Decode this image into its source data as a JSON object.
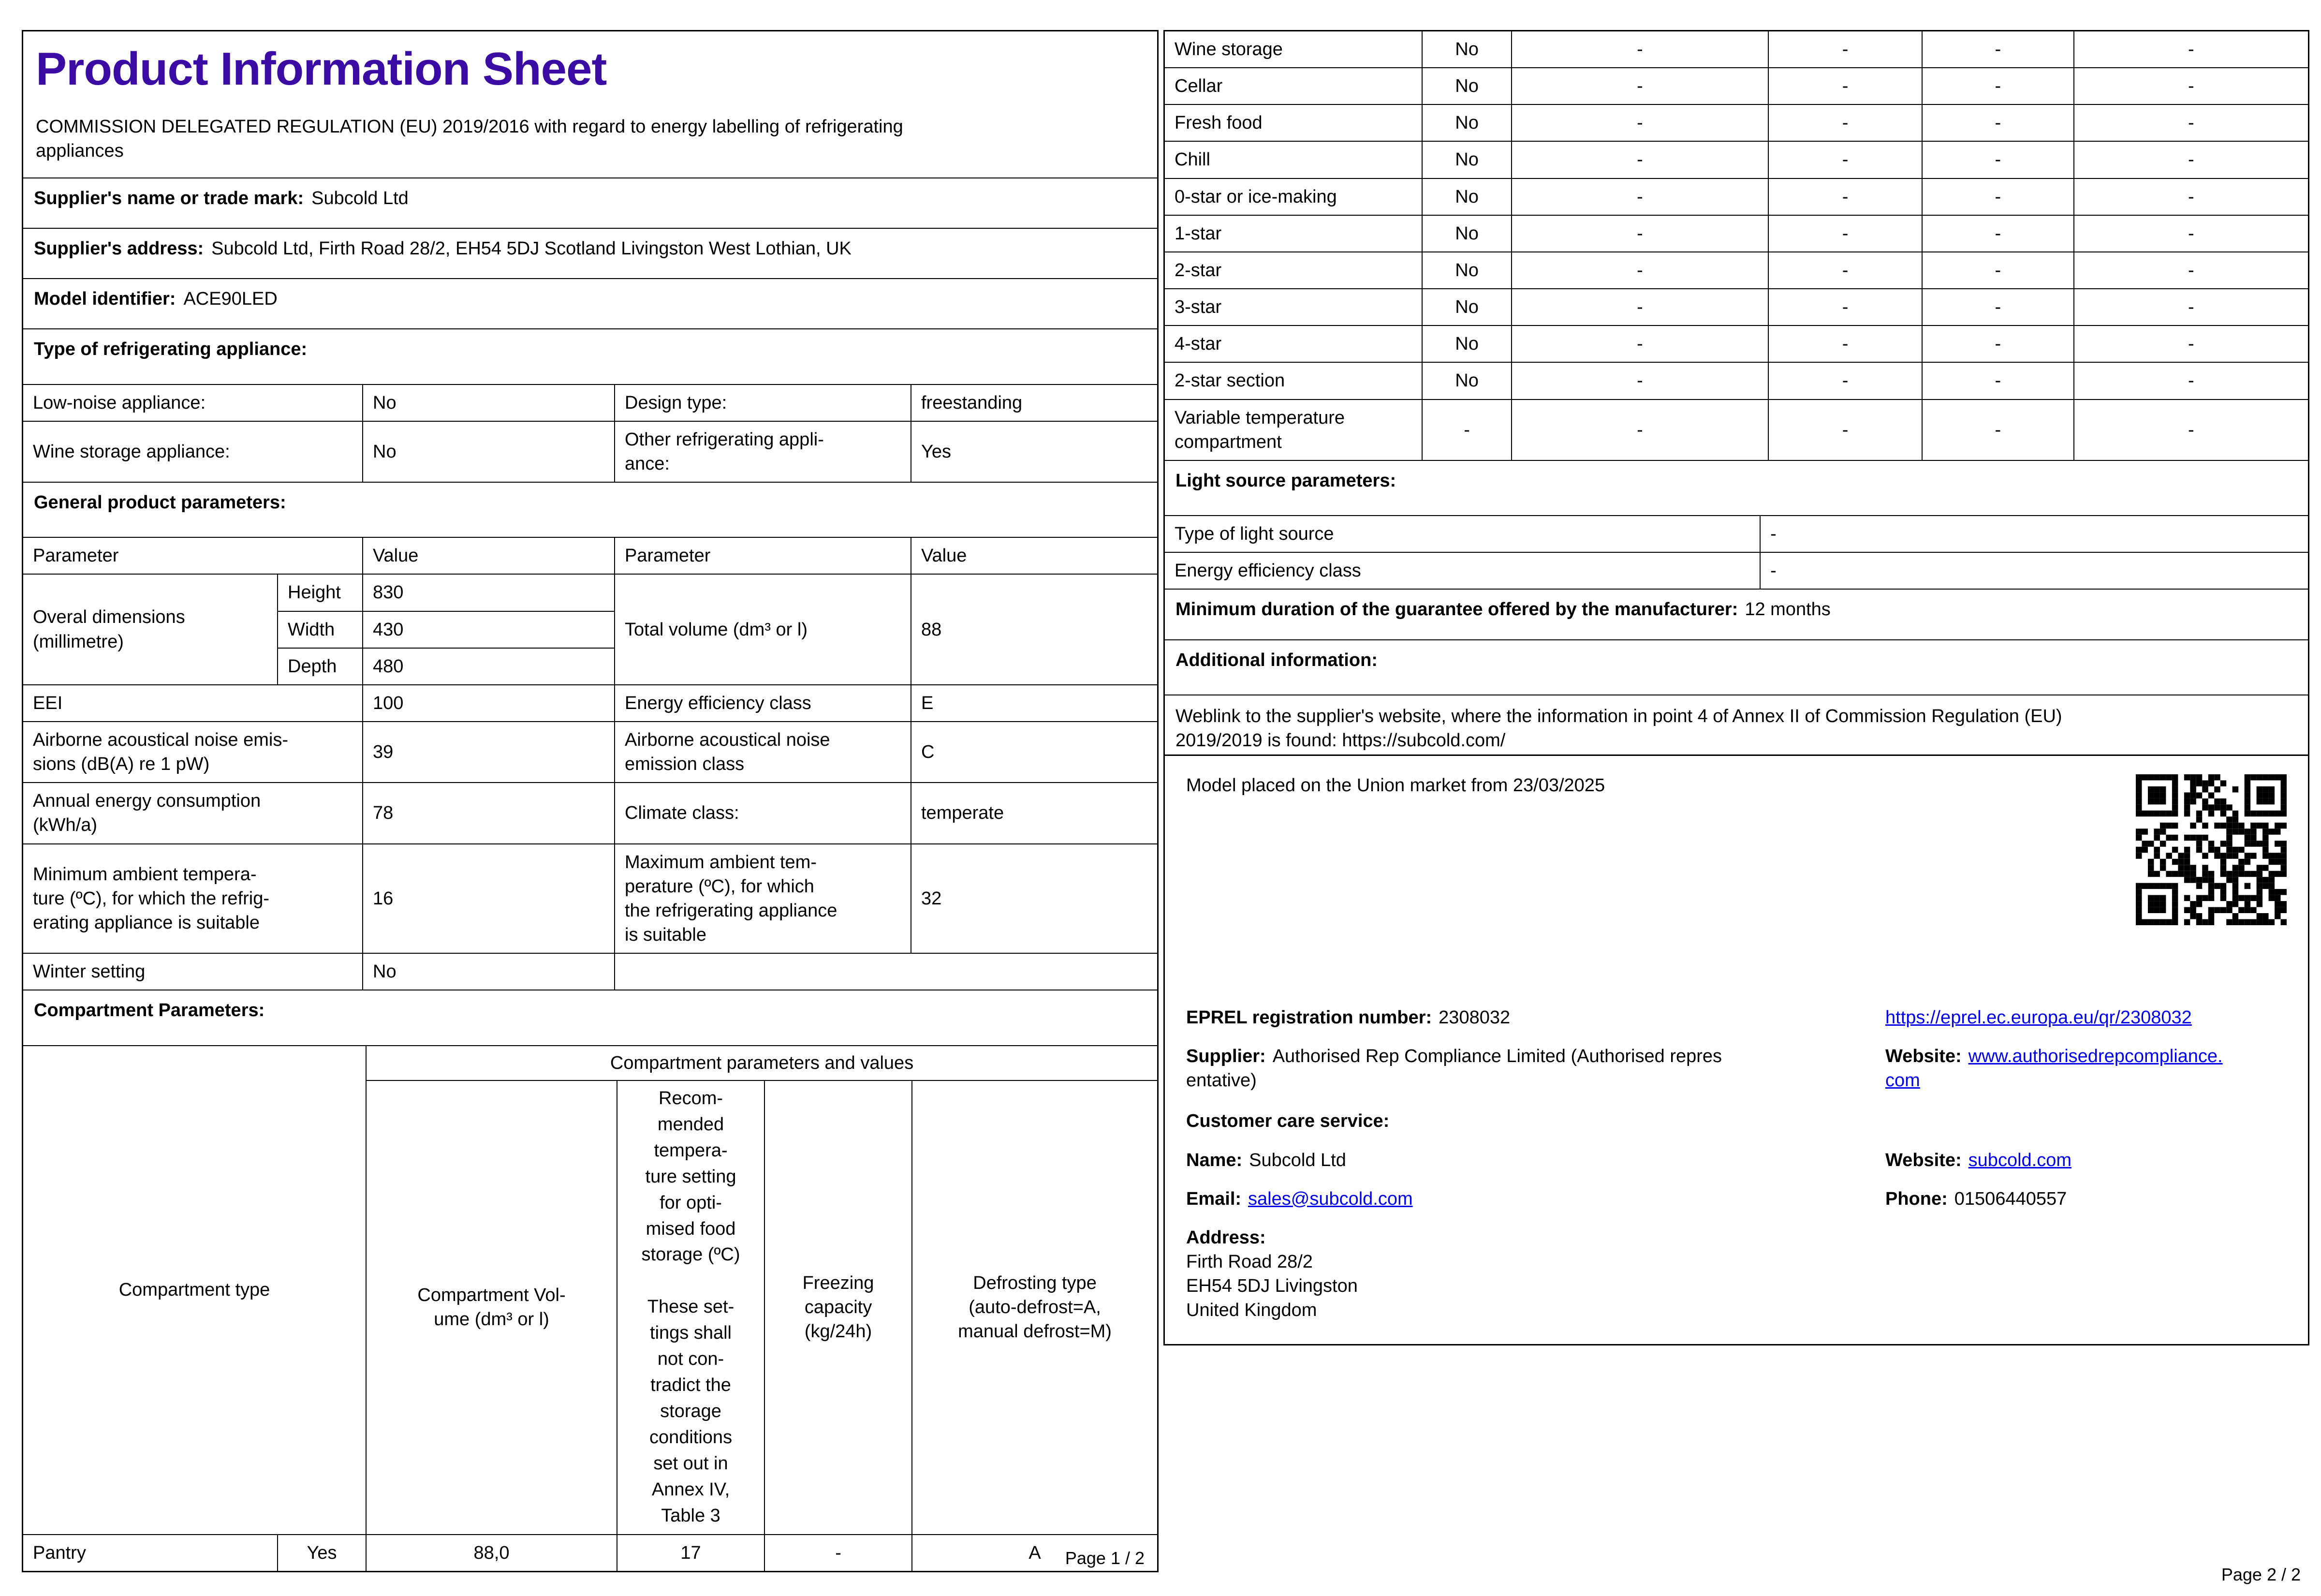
{
  "colors": {
    "title": "#3A0CA3",
    "link": "#0000EE",
    "border": "#000000"
  },
  "p1": {
    "title": "Product Information Sheet",
    "regulation": "COMMISSION DELEGATED REGULATION (EU) 2019/2016 with regard to energy labelling of refrigerating\nappliances",
    "supplier_name": {
      "label": "Supplier's name or trade mark:",
      "value": "Subcold Ltd"
    },
    "supplier_address": {
      "label": "Supplier's address:",
      "value": "Subcold Ltd, Firth Road 28/2, EH54 5DJ Scotland Livingston West Lothian, UK"
    },
    "model_identifier": {
      "label": "Model identifier:",
      "value": "ACE90LED"
    },
    "type_section": {
      "header": "Type of refrigerating appliance:",
      "low_noise": {
        "label": "Low-noise appliance:",
        "value": "No"
      },
      "design_type": {
        "label": "Design type:",
        "value": "freestanding"
      },
      "wine_storage": {
        "label": "Wine storage appliance:",
        "value": "No"
      },
      "other_appliance": {
        "label": "Other refrigerating appli-\nance:",
        "value": "Yes"
      }
    },
    "general_section": {
      "header": "General product parameters:",
      "col_parameter": "Parameter",
      "col_value": "Value",
      "dimensions": {
        "label": "Overal dimensions\n(millimetre)",
        "height_label": "Height",
        "height": "830",
        "width_label": "Width",
        "width": "430",
        "depth_label": "Depth",
        "depth": "480"
      },
      "total_volume": {
        "label": "Total volume (dm³ or l)",
        "value": "88"
      },
      "eei": {
        "label": "EEI",
        "value": "100"
      },
      "energy_class": {
        "label": "Energy efficiency class",
        "value": "E"
      },
      "noise": {
        "label": "Airborne acoustical noise emis-\nsions (dB(A) re 1 pW)",
        "value": "39"
      },
      "noise_class": {
        "label": "Airborne acoustical noise\nemission class",
        "value": "C"
      },
      "energy_consumption": {
        "label": "Annual energy consumption\n(kWh/a)",
        "value": "78"
      },
      "climate_class": {
        "label": "Climate class:",
        "value": "temperate"
      },
      "min_ambient": {
        "label": "Minimum ambient tempera-\nture (ºC), for which the refrig-\nerating appliance is suitable",
        "value": "16"
      },
      "max_ambient": {
        "label": "Maximum ambient tem-\nperature (ºC), for which\nthe refrigerating appliance\nis suitable",
        "value": "32"
      },
      "winter_setting": {
        "label": "Winter setting",
        "value": "No"
      }
    },
    "compartment_section": {
      "header": "Compartment Parameters:",
      "col_type": "Compartment type",
      "col_params": "Compartment parameters and values",
      "col_volume": "Compartment Vol-\nume (dm³ or l)",
      "col_temp": "Recom-\nmended\ntempera-\nture setting\nfor opti-\nmised food\nstorage (ºC)\n\nThese set-\ntings shall\nnot con-\ntradict the\nstorage\nconditions\nset out in\nAnnex IV,\nTable 3",
      "col_freezing": "Freezing\ncapacity\n(kg/24h)",
      "col_defrost": "Defrosting type\n(auto-defrost=A,\nmanual defrost=M)",
      "pantry": {
        "label": "Pantry",
        "present": "Yes",
        "volume": "88,0",
        "temp": "17",
        "freezing": "-",
        "defrost": "A"
      }
    },
    "footer": "Page 1 / 2"
  },
  "p2": {
    "compartment_rows": [
      {
        "label": "Wine storage",
        "present": "No",
        "values": [
          "-",
          "-",
          "-",
          "-"
        ]
      },
      {
        "label": "Cellar",
        "present": "No",
        "values": [
          "-",
          "-",
          "-",
          "-"
        ]
      },
      {
        "label": "Fresh food",
        "present": "No",
        "values": [
          "-",
          "-",
          "-",
          "-"
        ]
      },
      {
        "label": "Chill",
        "present": "No",
        "values": [
          "-",
          "-",
          "-",
          "-"
        ]
      },
      {
        "label": "0-star or ice-making",
        "present": "No",
        "values": [
          "-",
          "-",
          "-",
          "-"
        ]
      },
      {
        "label": "1-star",
        "present": "No",
        "values": [
          "-",
          "-",
          "-",
          "-"
        ]
      },
      {
        "label": "2-star",
        "present": "No",
        "values": [
          "-",
          "-",
          "-",
          "-"
        ]
      },
      {
        "label": "3-star",
        "present": "No",
        "values": [
          "-",
          "-",
          "-",
          "-"
        ]
      },
      {
        "label": "4-star",
        "present": "No",
        "values": [
          "-",
          "-",
          "-",
          "-"
        ]
      },
      {
        "label": "2-star section",
        "present": "No",
        "values": [
          "-",
          "-",
          "-",
          "-"
        ]
      },
      {
        "label": "Variable temperature\ncompartment",
        "present": "-",
        "values": [
          "-",
          "-",
          "-",
          "-"
        ]
      }
    ],
    "light_section": {
      "header": "Light source parameters:",
      "rows": [
        {
          "label": "Type of light source",
          "value": "-"
        },
        {
          "label": "Energy efficiency class",
          "value": "-"
        }
      ]
    },
    "guarantee": {
      "label": "Minimum duration of the guarantee offered by the manufacturer:",
      "value": "12 months"
    },
    "additional": {
      "header": "Additional information:",
      "weblink": "Weblink to the supplier's website, where the information in point 4 of Annex II of Commission Regulation (EU)\n2019/2019 is found:  https://subcold.com/"
    },
    "market_box": {
      "model_placed": "Model placed on the Union market from 23/03/2025",
      "eprel_label": "EPREL registration number:",
      "eprel_value": "2308032",
      "eprel_link": "https://eprel.ec.europa.eu/qr/2308032",
      "supplier_label": "Supplier:",
      "supplier_value": "Authorised Rep Compliance Limited (Authorised repres\nentative)",
      "website_label": "Website:",
      "website_link": "www.authorisedrepcompliance.\ncom",
      "care_header": "Customer care service:",
      "name_label": "Name:",
      "name_value": "Subcold Ltd",
      "website2_label": "Website:",
      "website2_link": "subcold.com",
      "email_label": "Email:",
      "email_link": "sales@subcold.com",
      "phone_label": "Phone:",
      "phone_value": "01506440557",
      "address_label": "Address:",
      "address_lines": "Firth Road 28/2\nEH54 5DJ Livingston\nUnited Kingdom"
    },
    "footer": "Page 2 / 2"
  }
}
